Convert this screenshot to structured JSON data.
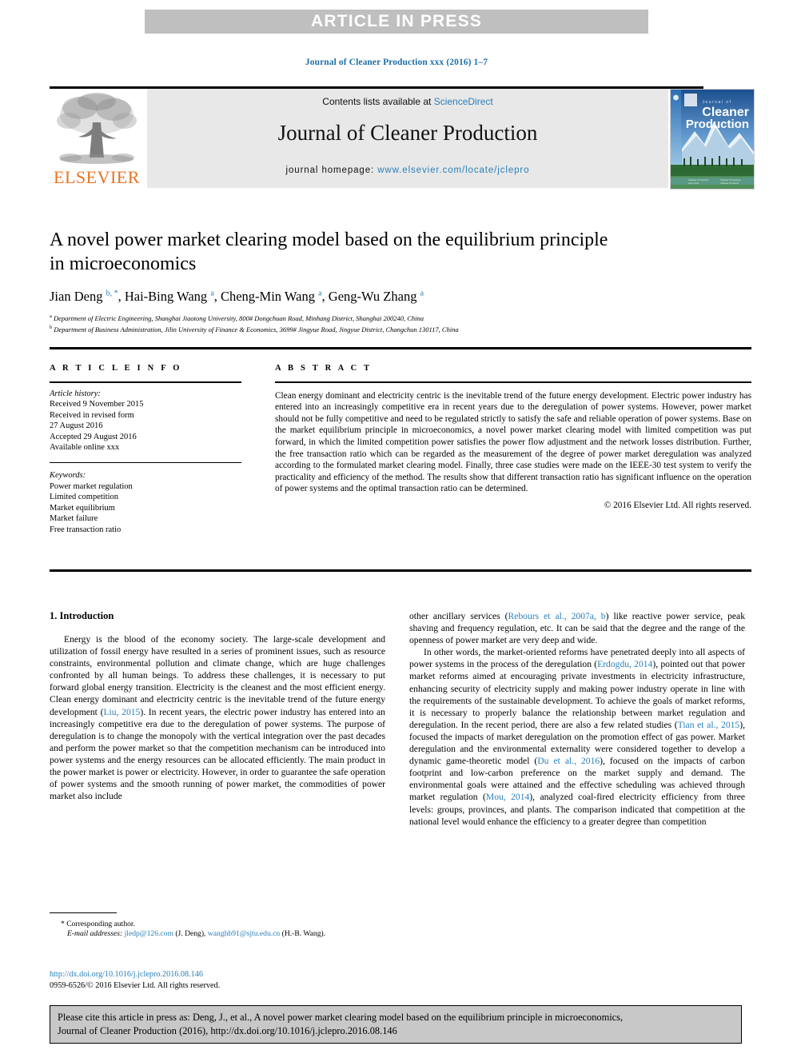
{
  "banner": {
    "text": "ARTICLE IN PRESS"
  },
  "running_head": {
    "text": "Journal of Cleaner Production xxx (2016) 1–7"
  },
  "masthead": {
    "contents_prefix": "Contents lists available at ",
    "sciencedirect": "ScienceDirect",
    "journal_name": "Journal of Cleaner Production",
    "homepage_prefix": "journal homepage: ",
    "homepage_url": "www.elsevier.com/locate/jclepro",
    "publisher_logo_word": "ELSEVIER",
    "cover_title_small": "Journal of",
    "cover_title_line1": "Cleaner",
    "cover_title_line2": "Production"
  },
  "article": {
    "title": "A novel power market clearing model based on the equilibrium principle in microeconomics",
    "authors_html": "Jian Deng <sup>b, *</sup>, Hai-Bing Wang <sup>a</sup>, Cheng-Min Wang <sup>a</sup>, Geng-Wu Zhang <sup>a</sup>",
    "affiliation_a": "Department of Electric Engineering, Shanghai Jiaotong University, 800# Dongchuan Road, Minhang District, Shanghai 200240, China",
    "affiliation_b": "Department of Business Administration, Jilin University of Finance & Economics, 3699# Jingyue Road, Jingyue District, Changchun 130117, China"
  },
  "info": {
    "heading": "A R T I C L E   I N F O",
    "history_label": "Article history:",
    "history_lines": [
      "Received 9 November 2015",
      "Received in revised form",
      "27 August 2016",
      "Accepted 29 August 2016",
      "Available online xxx"
    ],
    "keywords_label": "Keywords:",
    "keywords": [
      "Power market regulation",
      "Limited competition",
      "Market equilibrium",
      "Market failure",
      "Free transaction ratio"
    ]
  },
  "abstract": {
    "heading": "A B S T R A C T",
    "text": "Clean energy dominant and electricity centric is the inevitable trend of the future energy development. Electric power industry has entered into an increasingly competitive era in recent years due to the deregulation of power systems. However, power market should not be fully competitive and need to be regulated strictly to satisfy the safe and reliable operation of power systems. Base on the market equilibrium principle in microeconomics, a novel power market clearing model with limited competition was put forward, in which the limited competition power satisfies the power flow adjustment and the network losses distribution. Further, the free transaction ratio which can be regarded as the measurement of the degree of power market deregulation was analyzed according to the formulated market clearing model. Finally, three case studies were made on the IEEE-30 test system to verify the practicality and efficiency of the method. The results show that different transaction ratio has significant influence on the operation of power systems and the optimal transaction ratio can be determined.",
    "copyright": "© 2016 Elsevier Ltd. All rights reserved."
  },
  "body": {
    "section_heading": "1. Introduction",
    "left_paragraph_1_pre": "Energy is the blood of the economy society. The large-scale development and utilization of fossil energy have resulted in a series of prominent issues, such as resource constraints, environmental pollution and climate change, which are huge challenges confronted by all human beings. To address these challenges, it is necessary to put forward global energy transition. Electricity is the cleanest and the most efficient energy. Clean energy dominant and electricity centric is the inevitable trend of the future energy development (",
    "left_paragraph_1_ref": "Liu, 2015",
    "left_paragraph_1_post": "). In recent years, the electric power industry has entered into an increasingly competitive era due to the deregulation of power systems. The purpose of deregulation is to change the monopoly with the vertical integration over the past decades and perform the power market so that the competition mechanism can be introduced into power systems and the energy resources can be allocated efficiently. The main product in the power market is power or electricity. However, in order to guarantee the safe operation of power systems and the smooth running of power market, the commodities of power market also include",
    "right_paragraph_1_pre": "other ancillary services (",
    "right_paragraph_1_ref": "Rebours et al., 2007a, b",
    "right_paragraph_1_post": ") like reactive power service, peak shaving and frequency regulation, etc. It can be said that the degree and the range of the openness of power market are very deep and wide.",
    "right_paragraph_2_a": "In other words, the market-oriented reforms have penetrated deeply into all aspects of power systems in the process of the deregulation (",
    "right_paragraph_2_ref1": "Erdogdu, 2014",
    "right_paragraph_2_b": "), pointed out that power market reforms aimed at encouraging private investments in electricity infrastructure, enhancing security of electricity supply and making power industry operate in line with the requirements of the sustainable development. To achieve the goals of market reforms, it is necessary to properly balance the relationship between market regulation and deregulation. In the recent period, there are also a few related studies (",
    "right_paragraph_2_ref2": "Tian et al., 2015",
    "right_paragraph_2_c": "), focused the impacts of market deregulation on the promotion effect of gas power. Market deregulation and the environmental externality were considered together to develop a dynamic game-theoretic model (",
    "right_paragraph_2_ref3": "Du et al., 2016",
    "right_paragraph_2_d": "), focused on the impacts of carbon footprint and low-carbon preference on the market supply and demand. The environmental goals were attained and the effective scheduling was achieved through market regulation (",
    "right_paragraph_2_ref4": "Mou, 2014",
    "right_paragraph_2_e": "), analyzed coal-fired electricity efficiency from three levels: groups, provinces, and plants. The comparison indicated that competition at the national level would enhance the efficiency to a greater degree than competition"
  },
  "footnote": {
    "corresponding": "* Corresponding author.",
    "email_label": "E-mail addresses:",
    "email_1": "jledp@126.com",
    "email_1_owner": "(J. Deng),",
    "email_2": "wanghb91@sjtu.edu.cn",
    "email_2_owner": "(H.-B. Wang)."
  },
  "doi_block": {
    "doi_url": "http://dx.doi.org/10.1016/j.jclepro.2016.08.146",
    "issn_line": "0959-6526/© 2016 Elsevier Ltd. All rights reserved."
  },
  "cite_box": {
    "line1": "Please cite this article in press as: Deng, J., et al., A novel power market clearing model based on the equilibrium principle in microeconomics,",
    "line2": "Journal of Cleaner Production (2016), http://dx.doi.org/10.1016/j.jclepro.2016.08.146"
  },
  "colors": {
    "link_blue": "#2a7fb8",
    "elsevier_orange": "#e87422",
    "banner_gray": "#bfbfbf",
    "masthead_gray": "#e8e8e8",
    "cite_gray": "#c8c8c8"
  }
}
